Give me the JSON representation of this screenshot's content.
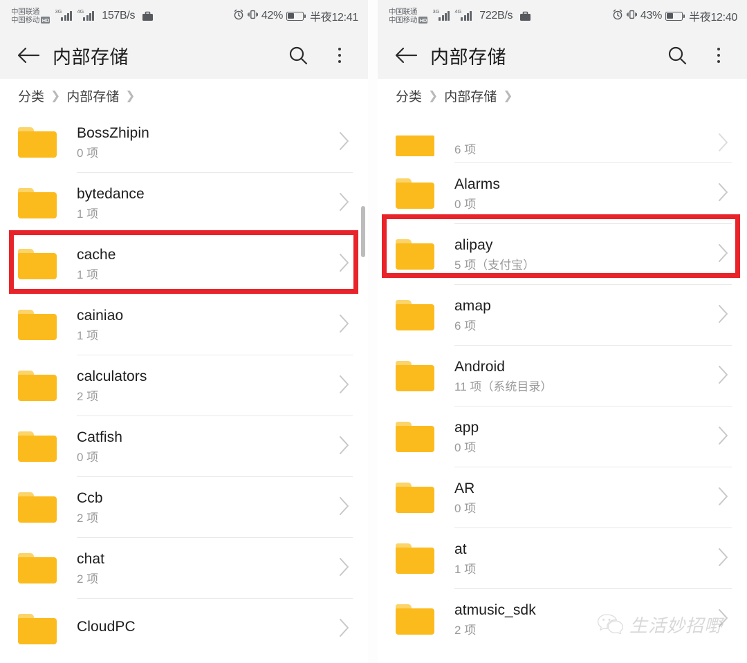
{
  "panels": [
    {
      "id": "left",
      "status_bar": {
        "carrier_primary": "中国联通",
        "carrier_secondary": "中国移动",
        "hd_badge": "HD",
        "net_type_1": "3G",
        "net_type_2": "4G",
        "network_speed": "157B/s",
        "battery_percent": "42%",
        "battery_level": 42,
        "clock": "半夜12:41"
      },
      "app_bar": {
        "title": "内部存储",
        "back_icon": "arrow-left-icon",
        "search_icon": "search-icon",
        "menu_icon": "kebab-menu-icon"
      },
      "breadcrumb": [
        "分类",
        "内部存储"
      ],
      "items": [
        {
          "name": "BossZhipin",
          "count": "0 项",
          "highlighted": false,
          "clipped": false
        },
        {
          "name": "bytedance",
          "count": "1 项",
          "highlighted": false,
          "clipped": false
        },
        {
          "name": "cache",
          "count": "1 项",
          "highlighted": true,
          "clipped": false
        },
        {
          "name": "cainiao",
          "count": "1 项",
          "highlighted": false,
          "clipped": false
        },
        {
          "name": "calculators",
          "count": "2 项",
          "highlighted": false,
          "clipped": false
        },
        {
          "name": "Catfish",
          "count": "0 项",
          "highlighted": false,
          "clipped": false
        },
        {
          "name": "Ccb",
          "count": "2 项",
          "highlighted": false,
          "clipped": false
        },
        {
          "name": "chat",
          "count": "2 项",
          "highlighted": false,
          "clipped": false
        },
        {
          "name": "CloudPC",
          "count": "",
          "highlighted": false,
          "clipped": false
        }
      ]
    },
    {
      "id": "right",
      "status_bar": {
        "carrier_primary": "中国联通",
        "carrier_secondary": "中国移动",
        "hd_badge": "HD",
        "net_type_1": "3G",
        "net_type_2": "4G",
        "network_speed": "722B/s",
        "battery_percent": "43%",
        "battery_level": 43,
        "clock": "半夜12:40"
      },
      "app_bar": {
        "title": "内部存储",
        "back_icon": "arrow-left-icon",
        "search_icon": "search-icon",
        "menu_icon": "kebab-menu-icon"
      },
      "breadcrumb": [
        "分类",
        "内部存储"
      ],
      "items": [
        {
          "name": "",
          "count": "6 项",
          "highlighted": false,
          "clipped": true
        },
        {
          "name": "Alarms",
          "count": "0 项",
          "highlighted": false,
          "clipped": false
        },
        {
          "name": "alipay",
          "count": "5 项（支付宝）",
          "highlighted": true,
          "clipped": false
        },
        {
          "name": "amap",
          "count": "6 项",
          "highlighted": false,
          "clipped": false
        },
        {
          "name": "Android",
          "count": "11 项（系统目录）",
          "highlighted": false,
          "clipped": false
        },
        {
          "name": "app",
          "count": "0 项",
          "highlighted": false,
          "clipped": false
        },
        {
          "name": "AR",
          "count": "0 项",
          "highlighted": false,
          "clipped": false
        },
        {
          "name": "at",
          "count": "1 项",
          "highlighted": false,
          "clipped": false
        },
        {
          "name": "atmusic_sdk",
          "count": "2 项",
          "highlighted": false,
          "clipped": false
        }
      ]
    }
  ],
  "watermark": {
    "text": "生活妙招嘢",
    "icon": "wechat-icon"
  },
  "colors": {
    "folder": "#fcbb1d",
    "folder_tab": "#fbd46a",
    "highlight": "#e8232a",
    "statusbar_bg": "#f3f3f3",
    "subtitle": "#9a9a9a"
  }
}
